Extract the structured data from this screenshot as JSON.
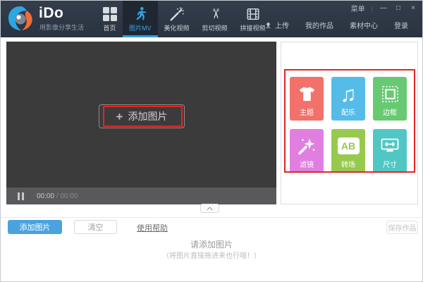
{
  "window": {
    "menu": "菜单",
    "minimize": "—",
    "maximize": "□",
    "close": "×"
  },
  "header": {
    "logo": "iDo",
    "tagline": "用影像分享生活",
    "nav": [
      {
        "label": "首页",
        "icon": "grid-icon",
        "active": false
      },
      {
        "label": "图片MV",
        "icon": "running-person-icon",
        "active": true
      },
      {
        "label": "美化视频",
        "icon": "magic-wand-icon",
        "active": false
      },
      {
        "label": "剪切视频",
        "icon": "scissors-icon",
        "active": false
      },
      {
        "label": "拼接视频",
        "icon": "film-strip-icon",
        "active": false
      }
    ],
    "actions": {
      "upload": "上传",
      "upload_icon": "upload-arrow-icon",
      "my_works": "我的作品",
      "material_center": "素材中心",
      "login": "登录"
    }
  },
  "player": {
    "add_plus": "+",
    "add_label": "添加图片",
    "current_time": "00:00",
    "time_separator": "/",
    "total_time": "00:00"
  },
  "tools": {
    "tiles": [
      {
        "label": "主题",
        "color": "#f2716b",
        "icon": "tshirt-icon"
      },
      {
        "label": "配乐",
        "color": "#55bce9",
        "icon": "music-note-icon",
        "glyph": "♫"
      },
      {
        "label": "边框",
        "color": "#68c973",
        "icon": "stamp-frame-icon"
      },
      {
        "label": "滤镜",
        "color": "#e17fe0",
        "icon": "magic-wand-star-icon"
      },
      {
        "label": "转场",
        "color": "#97c94f",
        "icon": "ab-letters-icon",
        "icon_text": "AB"
      },
      {
        "label": "尺寸",
        "color": "#50c7c3",
        "icon": "screen-size-icon"
      }
    ]
  },
  "footer": {
    "add_images": "添加图片",
    "clear": "清空",
    "help": "使用帮助",
    "save": "保存作品",
    "empty_title": "请添加图片",
    "empty_hint": "（将图片直接拖进来也行哦！）"
  },
  "colors": {
    "accent_blue": "#38a4e4",
    "annotation_red": "#e62424",
    "primary_button_blue": "#4aa3df"
  }
}
